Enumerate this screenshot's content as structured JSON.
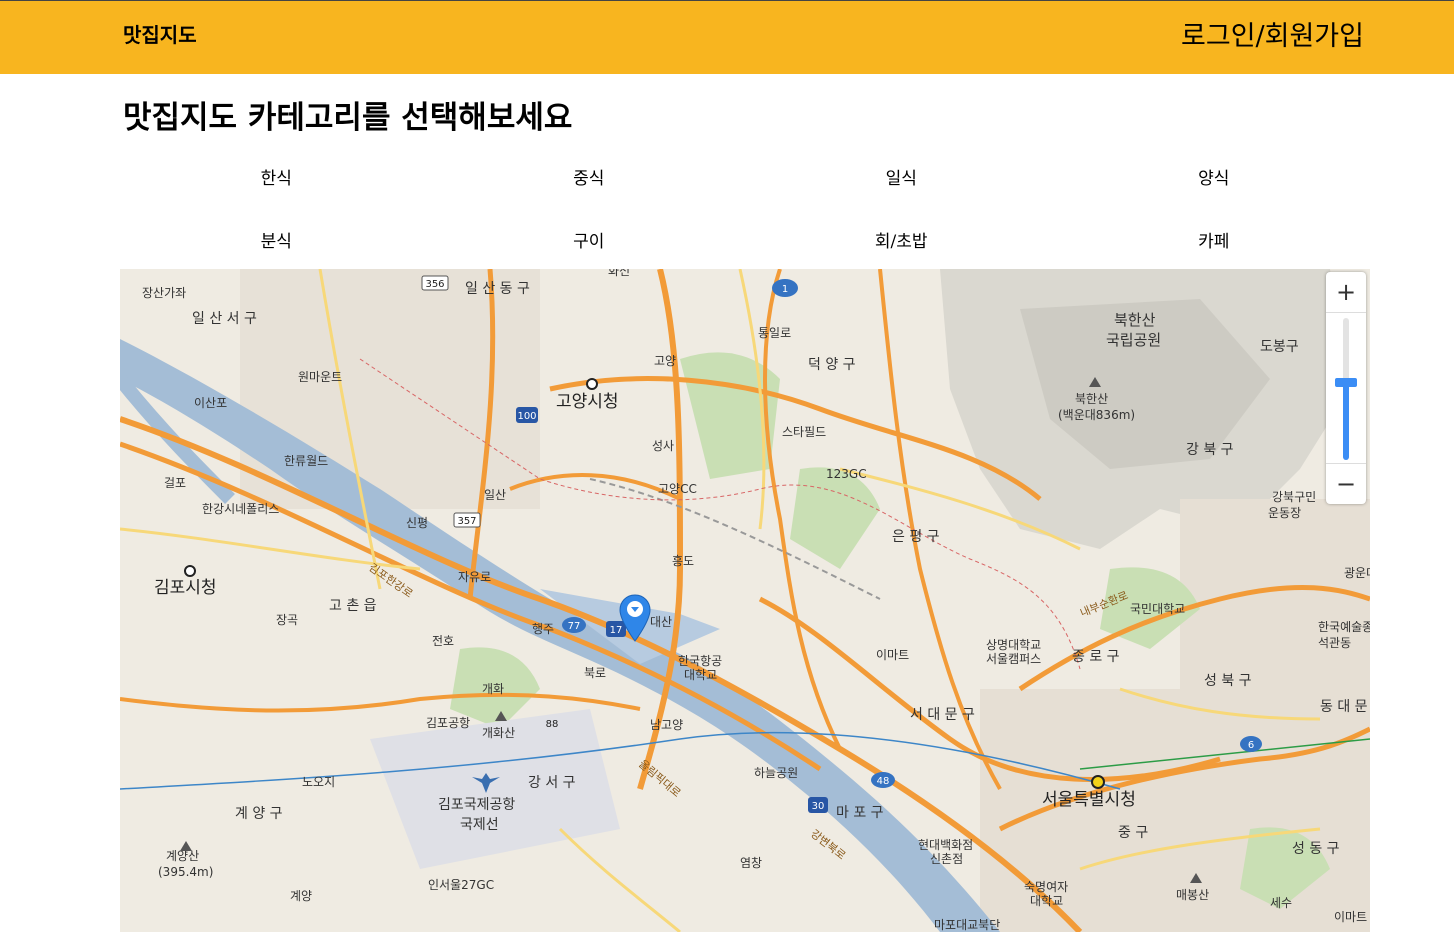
{
  "header": {
    "brand": "맛집지도",
    "auth_link": "로그인/회원가입"
  },
  "page_title": "맛집지도 카테고리를 선택해보세요",
  "categories": [
    "한식",
    "중식",
    "일식",
    "양식",
    "분식",
    "구이",
    "회/초밥",
    "카페"
  ],
  "map": {
    "zoom_in": "+",
    "zoom_out": "−",
    "zoom_level": 0.55,
    "labels": {
      "jangsan": "장산가좌",
      "ilsandong": "일 산 동 구",
      "ilsanseo": "일 산 서 구",
      "wonmaun": "원마운트",
      "isanpo": "이산포",
      "hanryu": "한류월드",
      "geolpo": "걸포",
      "hangang_np": "한강시네폴리스",
      "gimpo_city": "김포시청",
      "janggok": "장곡",
      "goneup": "고 촌 읍",
      "jeonho": "전호",
      "haengju": "행주",
      "gaehwa": "개화",
      "gimpo_airport_stn": "김포공항",
      "gaehwasan": "개화산",
      "nojoji": "노오지",
      "gyeyang_gu": "계 양 구",
      "gyeyangsan": "계양산",
      "gyeyangsan_h": "(395.4m)",
      "gyeyang": "계양",
      "goyang_city": "고양시청",
      "goyang": "고양",
      "tongil": "통일로",
      "deokyang": "덕 양 구",
      "seongsa": "성사",
      "starfield": "스타필드",
      "gc123": "123GC",
      "goyang_cc": "고양CC",
      "ilsan": "일산",
      "sinpyeong": "신평",
      "jayuro": "자유로",
      "hwajeon": "화전",
      "daesan": "대산",
      "hongdo": "흥도",
      "kau": "한국항공",
      "kau2": "대학교",
      "bukro": "북로",
      "namgoyang": "남고양",
      "gangseo": "강 서 구",
      "gimpo_intl": "김포국제공항",
      "gimpo_intl2": "국제선",
      "incheon27": "인서울27GC",
      "haneul": "하늘공원",
      "mapo": "마 포 구",
      "yeomchang": "염창",
      "hyundai": "현대백화점",
      "hyundai2": "신촌점",
      "bukhansan_np": "북한산",
      "bukhansan_np2": "국립공원",
      "bukhansan_peak": "북한산",
      "bukhansan_peak2": "(백운대836m)",
      "dobong": "도봉구",
      "gangbuk": "강 북 구",
      "gangbuk_stad": "강북구민",
      "gangbuk_stad2": "운동장",
      "eunpyeong": "은 평 구",
      "emart": "이마트",
      "sangmyung": "상명대학교",
      "sangmyung2": "서울캠퍼스",
      "kookmin": "국민대학교",
      "jongno": "종 로 구",
      "seodaemun": "서 대 문 구",
      "seongbuk": "성 북 구",
      "seoul_city": "서울특별시청",
      "junggu": "중 구",
      "sookmyung": "숙명여자",
      "sookmyung2": "대학교",
      "maebongsan": "매봉산",
      "mapogyo": "마포대교북단",
      "gwangun": "광운대",
      "karts": "한국예술종",
      "karts2": "석관동",
      "dongdae": "동 대 문",
      "seongdong": "성 동 구",
      "emart2": "이마트",
      "sesu": "세수",
      "gimpo_hanggang_rd": "김포한강로",
      "olympic_rd": "올림픽대로",
      "gangbyeon_rd": "강변북로",
      "naebu_rd": "내부순환로",
      "rt356": "356",
      "rt357": "357",
      "rt100": "100",
      "rt1": "1",
      "rt17": "17",
      "rt77": "77",
      "rt88": "88",
      "rt48": "48",
      "rt30": "30",
      "rt6": "6"
    }
  }
}
